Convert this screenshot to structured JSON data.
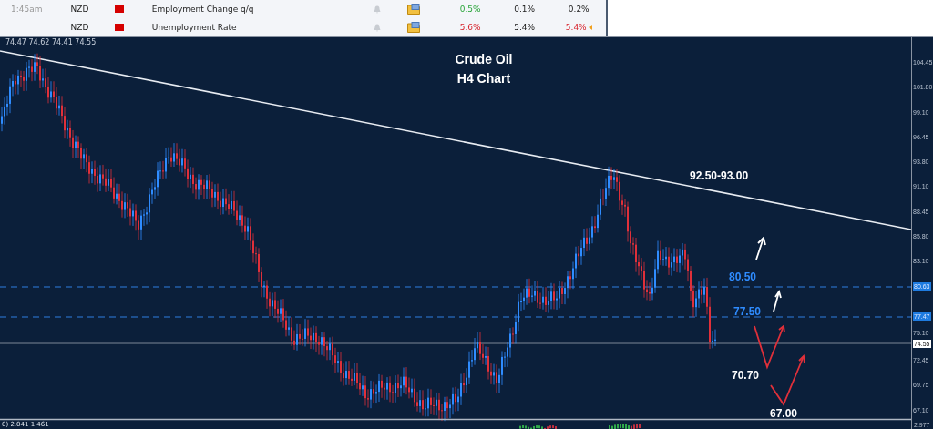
{
  "calendar": {
    "rows": [
      {
        "time": "1:45am",
        "currency": "NZD",
        "event": "Employment Change q/q",
        "actual": "0.5%",
        "beat_forecast": true,
        "forecast": "0.1%",
        "previous": "0.2%",
        "previous_revised": false
      },
      {
        "currency": "NZD",
        "event": "Unemployment Rate",
        "actual": "5.6%",
        "beat_forecast": false,
        "forecast": "5.4%",
        "previous": "5.4%",
        "previous_revised": true
      }
    ]
  },
  "chart": {
    "quote": "74.47 74.62 74.41 74.55",
    "title": [
      "Crude Oil",
      "H4 Chart"
    ],
    "annotations": [
      {
        "label": "92.50-93.00",
        "kind": "target"
      },
      {
        "label": "80.50",
        "kind": "level"
      },
      {
        "label": "77.50",
        "kind": "level"
      },
      {
        "label": "70.70",
        "kind": "target"
      },
      {
        "label": "67.00",
        "kind": "target"
      }
    ],
    "price_axis": {
      "ticks": [
        "104.45",
        "101.80",
        "99.10",
        "96.45",
        "93.80",
        "91.10",
        "88.45",
        "85.80",
        "83.10",
        "75.10",
        "72.45",
        "69.75",
        "67.10"
      ],
      "markers": [
        {
          "label": "80.63",
          "kind": "level"
        },
        {
          "label": "77.47",
          "kind": "level"
        },
        {
          "label": "74.55",
          "kind": "current"
        }
      ]
    },
    "indicator": {
      "header": "0) 2.041 1.461",
      "axis_label": "2.977"
    }
  }
}
